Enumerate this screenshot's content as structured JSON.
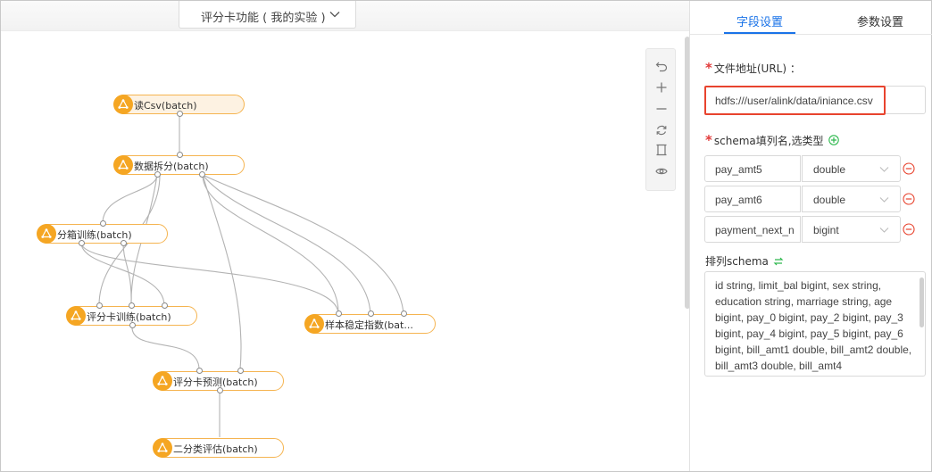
{
  "experiment_selector": {
    "label": "评分卡功能 ( 我的实验 )",
    "icon": "chevron-down-icon"
  },
  "nodes": [
    {
      "id": "read_csv",
      "label": "读Csv(batch)",
      "icon": "component-icon"
    },
    {
      "id": "split",
      "label": "数据拆分(batch)",
      "icon": "component-icon"
    },
    {
      "id": "binning",
      "label": "分箱训练(batch)",
      "icon": "component-icon"
    },
    {
      "id": "scorecard_train",
      "label": "评分卡训练(batch)",
      "icon": "component-icon"
    },
    {
      "id": "psi",
      "label": "样本稳定指数(bat...",
      "icon": "component-icon"
    },
    {
      "id": "scorecard_predict",
      "label": "评分卡预测(batch)",
      "icon": "component-icon"
    },
    {
      "id": "binary_eval",
      "label": "二分类评估(batch)",
      "icon": "component-icon"
    }
  ],
  "toolbar": {
    "items": [
      "undo-icon",
      "zoom-in-icon",
      "zoom-out-icon",
      "refresh-icon",
      "fit-screen-icon",
      "preview-eye-icon"
    ]
  },
  "panel": {
    "tabs": [
      {
        "label": "字段设置",
        "active": true
      },
      {
        "label": "参数设置",
        "active": false
      }
    ],
    "file_path": {
      "required_mark": "*",
      "label": "文件地址(URL) ：",
      "value": "hdfs:///user/alink/data/iniance.csv"
    },
    "schema": {
      "required_mark": "*",
      "label": "schema填列名,选类型",
      "rows": [
        {
          "name": "pay_amt5",
          "type": "double"
        },
        {
          "name": "pay_amt6",
          "type": "double"
        },
        {
          "name": "payment_next_n",
          "type": "bigint"
        }
      ]
    },
    "sorted_schema": {
      "label": "排列schema",
      "text": "id string, limit_bal  bigint, sex  string, education  string, marriage  string, age  bigint, pay_0 bigint, pay_2 bigint, pay_3 bigint, pay_4 bigint, pay_5 bigint, pay_6 bigint, bill_amt1  double, bill_amt2  double, bill_amt3  double, bill_amt4"
    }
  },
  "colors": {
    "node_border": "#f5b450",
    "node_icon": "#f5a623",
    "accent": "#1a73e8",
    "highlight": "#e8432e"
  }
}
